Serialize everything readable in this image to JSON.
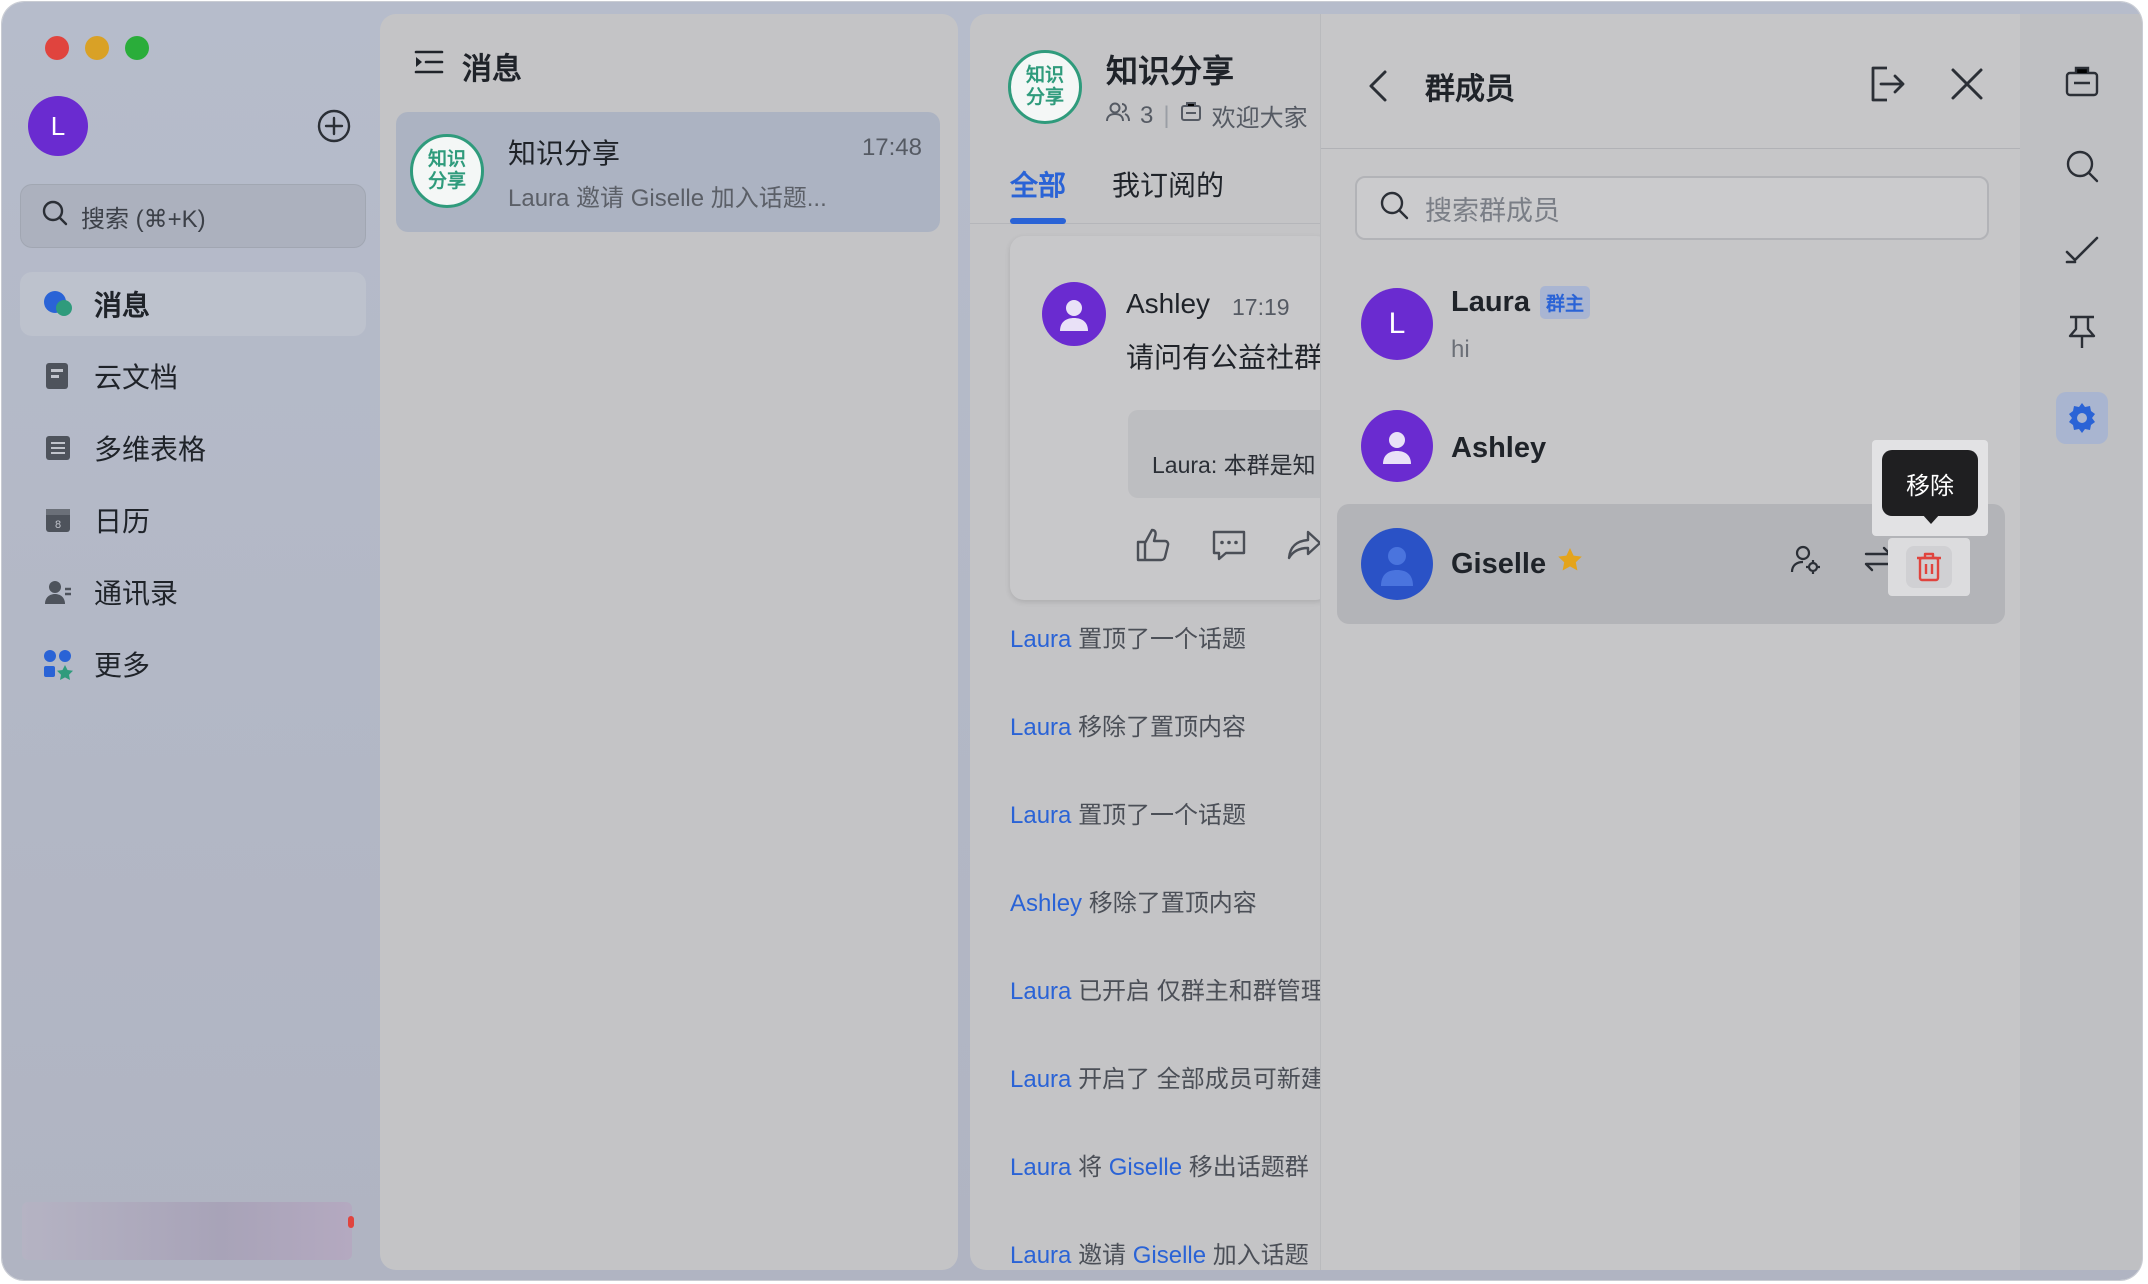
{
  "sidebar": {
    "user_avatar_letter": "L",
    "search_placeholder": "搜索 (⌘+K)",
    "items": [
      {
        "label": "消息",
        "icon": "messages-icon"
      },
      {
        "label": "云文档",
        "icon": "docs-icon"
      },
      {
        "label": "多维表格",
        "icon": "base-table-icon"
      },
      {
        "label": "日历",
        "icon": "calendar-icon"
      },
      {
        "label": "通讯录",
        "icon": "contacts-icon"
      },
      {
        "label": "更多",
        "icon": "more-apps-icon"
      }
    ]
  },
  "message_list": {
    "title": "消息",
    "chats": [
      {
        "avatar_text": "知识分享",
        "name": "知识分享",
        "time": "17:48",
        "preview": "Laura 邀请 Giselle 加入话题..."
      }
    ]
  },
  "conversation": {
    "avatar_text": "知识分享",
    "title": "知识分享",
    "member_count": "3",
    "announcement": "欢迎大家",
    "tabs": [
      "全部",
      "我订阅的"
    ],
    "post": {
      "author": "Ashley",
      "time": "17:19",
      "text": "请问有公益社群",
      "quote": "Laura: 本群是知"
    },
    "events": [
      {
        "actor": "Laura",
        "text": "置顶了一个话题",
        "target": "",
        "suffix": ""
      },
      {
        "actor": "Laura",
        "text": "移除了置顶内容",
        "target": "",
        "suffix": ""
      },
      {
        "actor": "Laura",
        "text": "置顶了一个话题",
        "target": "",
        "suffix": ""
      },
      {
        "actor": "Ashley",
        "text": "移除了置顶内容",
        "target": "",
        "suffix": ""
      },
      {
        "actor": "Laura",
        "text": "已开启 仅群主和群管理",
        "target": "",
        "suffix": ""
      },
      {
        "actor": "Laura",
        "text": "开启了 全部成员可新建",
        "target": "",
        "suffix": ""
      },
      {
        "actor": "Laura",
        "text": "将",
        "target": "Giselle",
        "suffix": "移出话题群"
      },
      {
        "actor": "Laura",
        "text": "邀请",
        "target": "Giselle",
        "suffix": "加入话题"
      }
    ]
  },
  "members_panel": {
    "title": "群成员",
    "search_placeholder": "搜索群成员",
    "members": [
      {
        "name": "Laura",
        "badge": "群主",
        "sub": "hi",
        "avatar_letter": "L",
        "avatar_color": "#6a2bd0"
      },
      {
        "name": "Ashley",
        "badge": "",
        "sub": "",
        "avatar_letter": "",
        "avatar_color": "#6a2bd0"
      },
      {
        "name": "Giselle",
        "badge": "",
        "sub": "",
        "avatar_letter": "",
        "avatar_color": "#2a52c6"
      }
    ],
    "tooltip": "移除"
  },
  "right_toolbar": {
    "icons": [
      "briefcase-icon",
      "search-icon",
      "checkmark-icon",
      "pin-icon",
      "settings-icon"
    ]
  },
  "colors": {
    "accent": "#2a63d6",
    "danger": "#e0443e",
    "group_green": "#2f9b7c",
    "avatar_purple": "#6a2bd0"
  }
}
